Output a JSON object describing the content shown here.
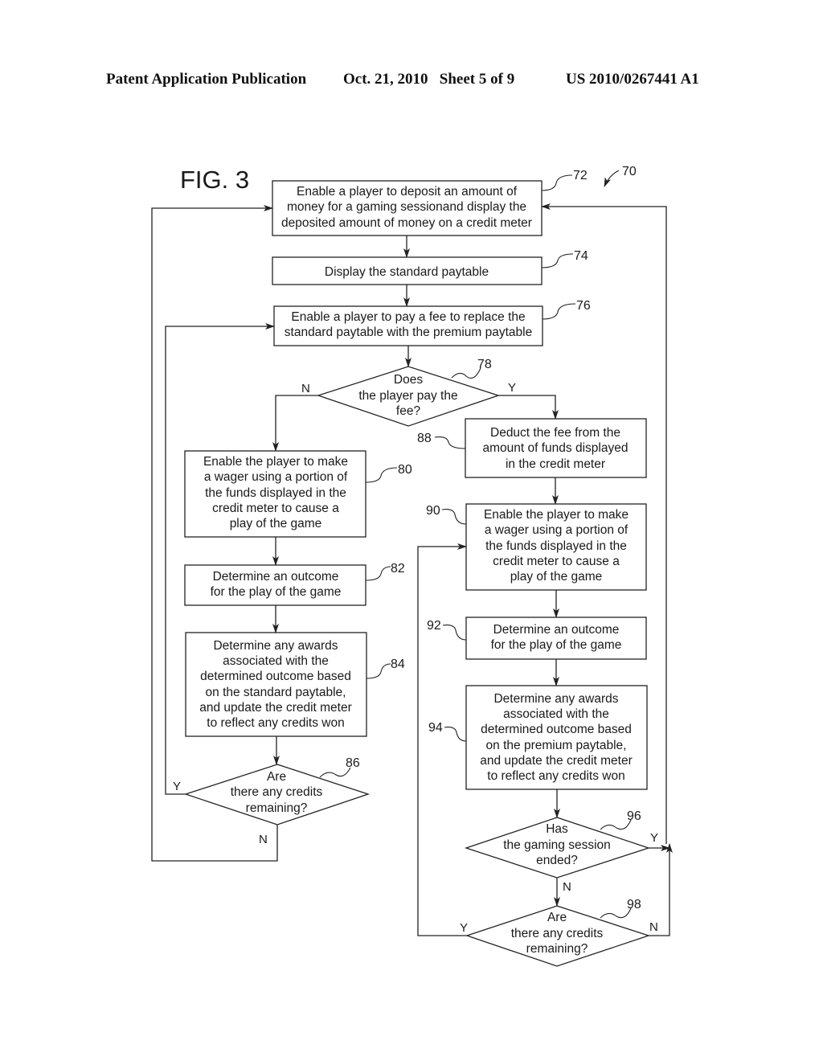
{
  "header": {
    "publication": "Patent Application Publication",
    "date_sheet": "Oct. 21, 2010   Sheet 5 of 9",
    "number": "US 2010/0267441 A1"
  },
  "figure": {
    "label": "FIG. 3",
    "ref": "70"
  },
  "nodes": {
    "n72": {
      "ref": "72",
      "lines": [
        "Enable a player to deposit an amount of",
        "money for a gaming sessionand display the",
        "deposited amount of money on a credit meter"
      ]
    },
    "n74": {
      "ref": "74",
      "lines": [
        "Display the standard paytable"
      ]
    },
    "n76": {
      "ref": "76",
      "lines": [
        "Enable a player to pay a fee to replace the",
        "standard paytable with the premium paytable"
      ]
    },
    "n78": {
      "ref": "78",
      "lines": [
        "Does",
        "the player pay the",
        "fee?"
      ],
      "yes": "Y",
      "no": "N"
    },
    "n80": {
      "ref": "80",
      "lines": [
        "Enable the player to make",
        "a wager using a portion of",
        "the funds displayed in the",
        "credit meter to cause a",
        "play of the game"
      ]
    },
    "n82": {
      "ref": "82",
      "lines": [
        "Determine an outcome",
        "for the play of the game"
      ]
    },
    "n84": {
      "ref": "84",
      "lines": [
        "Determine any awards",
        "associated with the",
        "determined outcome based",
        "on the standard paytable,",
        "and update the credit meter",
        "to reflect any credits won"
      ]
    },
    "n86": {
      "ref": "86",
      "lines": [
        "Are",
        "there any credits",
        "remaining?"
      ],
      "yes": "Y",
      "no": "N"
    },
    "n88": {
      "ref": "88",
      "lines": [
        "Deduct the fee from the",
        "amount of funds displayed",
        "in the credit meter"
      ]
    },
    "n90": {
      "ref": "90",
      "lines": [
        "Enable the player to make",
        "a wager using a portion of",
        "the funds displayed in the",
        "credit meter to cause a",
        "play of the game"
      ]
    },
    "n92": {
      "ref": "92",
      "lines": [
        "Determine an outcome",
        "for the play of the game"
      ]
    },
    "n94": {
      "ref": "94",
      "lines": [
        "Determine any awards",
        "associated with the",
        "determined outcome based",
        "on the premium paytable,",
        "and update the credit meter",
        "to reflect any credits won"
      ]
    },
    "n96": {
      "ref": "96",
      "lines": [
        "Has",
        "the gaming session",
        "ended?"
      ],
      "yes": "Y",
      "no": "N"
    },
    "n98": {
      "ref": "98",
      "lines": [
        "Are",
        "there any credits",
        "remaining?"
      ],
      "yes": "Y",
      "no": "N"
    }
  }
}
